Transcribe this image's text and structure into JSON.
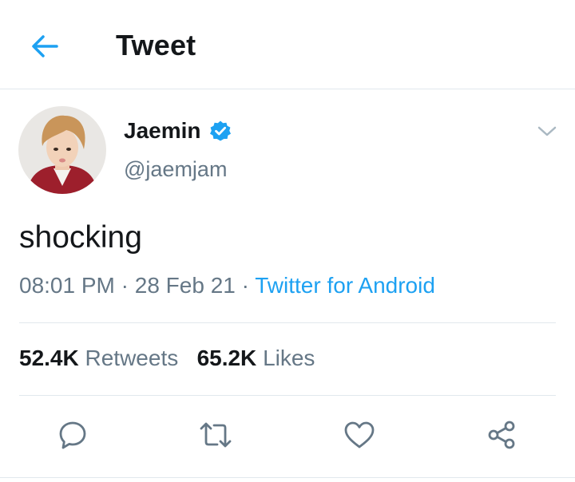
{
  "header": {
    "title": "Tweet",
    "back_icon": "arrow-left-icon"
  },
  "author": {
    "name": "Jaemin",
    "handle": "@jaemjam",
    "verified_icon": "verified-badge-icon"
  },
  "tweet": {
    "text": "shocking",
    "time": "08:01 PM",
    "separator": " · ",
    "date": "28 Feb 21",
    "source": "Twitter for Android"
  },
  "stats": {
    "retweets_count": "52.4K",
    "retweets_label": "Retweets",
    "likes_count": "65.2K",
    "likes_label": "Likes"
  },
  "actions": [
    "reply-icon",
    "retweet-icon",
    "like-icon",
    "share-icon"
  ],
  "colors": {
    "accent": "#1da1f2",
    "muted": "#657786",
    "text": "#14171a",
    "divider": "#e1e8ed"
  }
}
